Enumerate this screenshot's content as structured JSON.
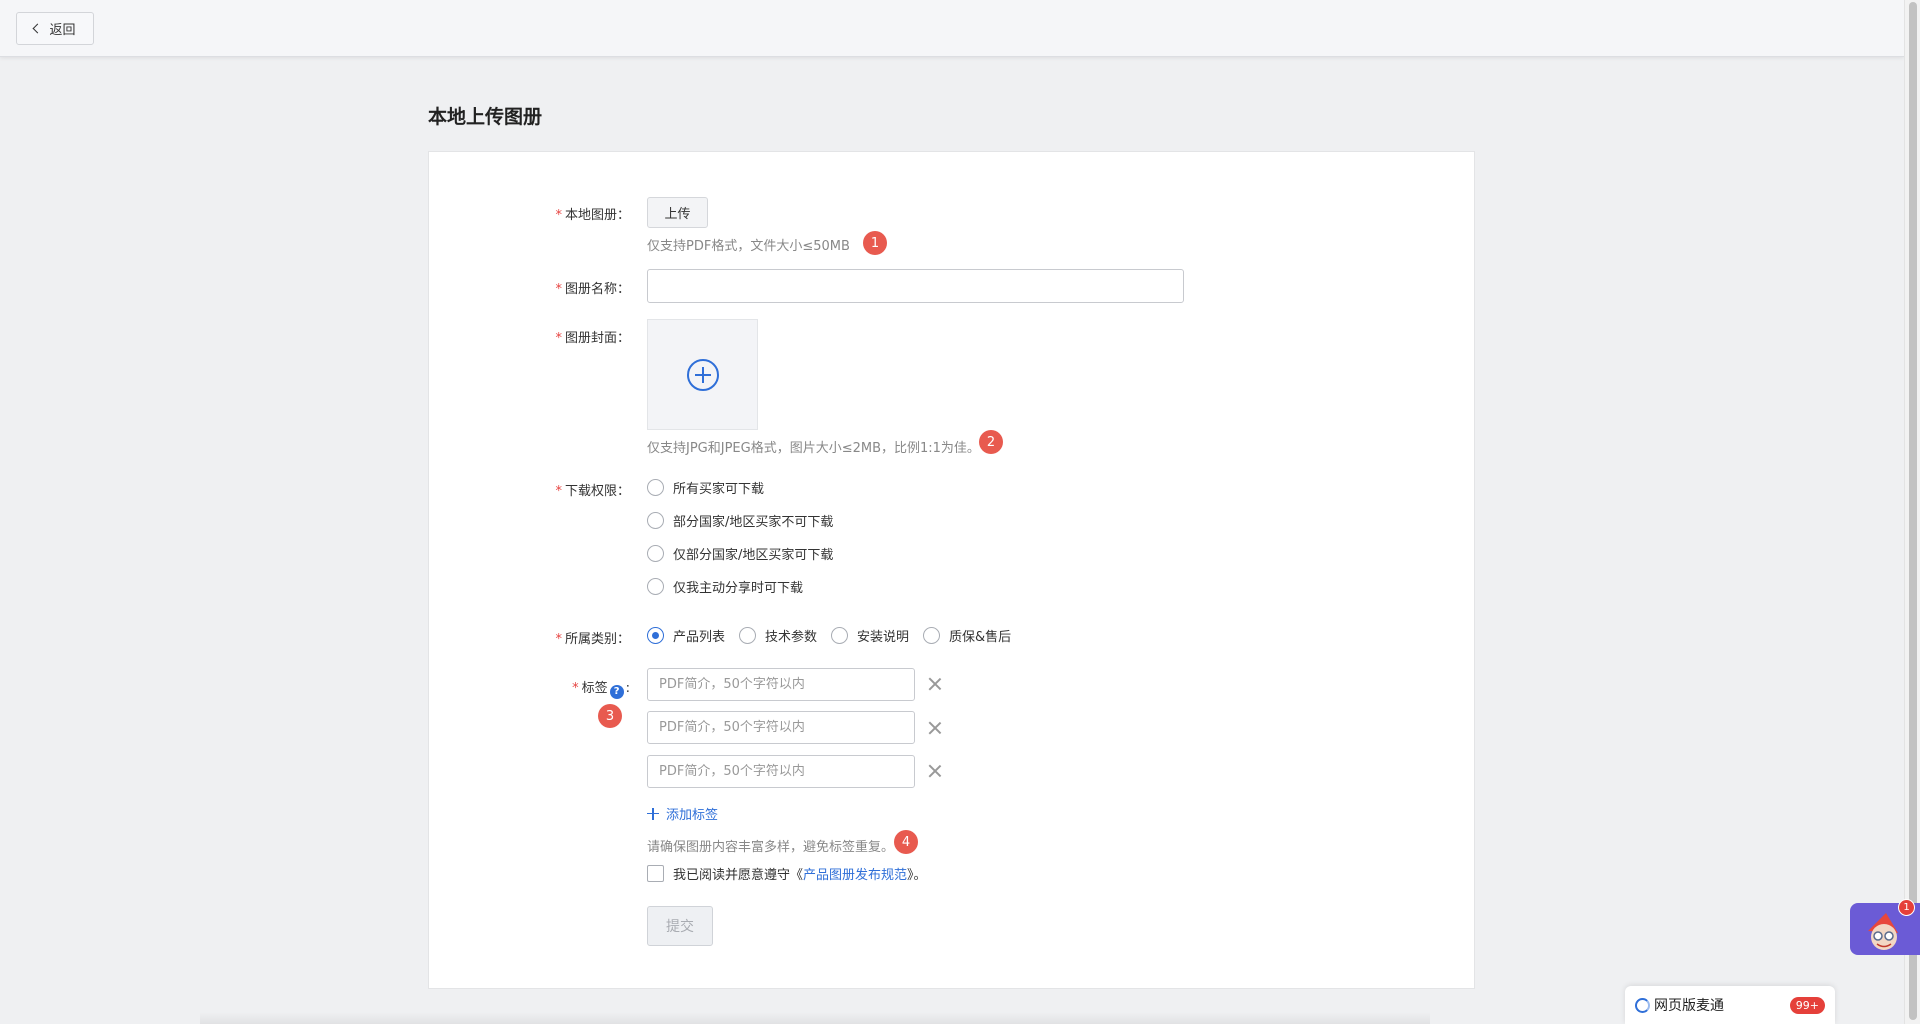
{
  "topbar": {
    "back_label": "返回"
  },
  "page": {
    "title": "本地上传图册"
  },
  "form": {
    "local_album": {
      "label": "本地图册：",
      "upload_label": "上传",
      "hint": "仅支持PDF格式，文件大小≤50MB",
      "badge": "1"
    },
    "album_name": {
      "label": "图册名称：",
      "value": ""
    },
    "cover": {
      "label": "图册封面：",
      "hint": "仅支持JPG和JPEG格式，图片大小≤2MB，比例1:1为佳。",
      "badge": "2"
    },
    "download": {
      "label": "下载权限：",
      "options": [
        "所有买家可下载",
        "部分国家/地区买家不可下载",
        "仅部分国家/地区买家可下载",
        "仅我主动分享时可下载"
      ],
      "selected": null
    },
    "category": {
      "label": "所属类别：",
      "options": [
        "产品列表",
        "技术参数",
        "安装说明",
        "质保&售后"
      ],
      "selected": "产品列表"
    },
    "tags": {
      "label": "标签",
      "colon": ":",
      "help": "?",
      "badge": "3",
      "placeholder": "PDF简介，50个字符以内",
      "add_label": "添加标签",
      "hint": "请确保图册内容丰富多样，避免标签重复。",
      "hint_badge": "4"
    },
    "agreement": {
      "prefix": "我已阅读并愿意遵守《",
      "link": "产品图册发布规范",
      "suffix": "》。"
    },
    "submit_label": "提交"
  },
  "assistant": {
    "notification_count": "1"
  },
  "im": {
    "label": "网页版麦通",
    "count": "99+"
  },
  "colors": {
    "accent": "#2f6fd8",
    "badge": "#e85a4f",
    "required": "#e64340"
  }
}
